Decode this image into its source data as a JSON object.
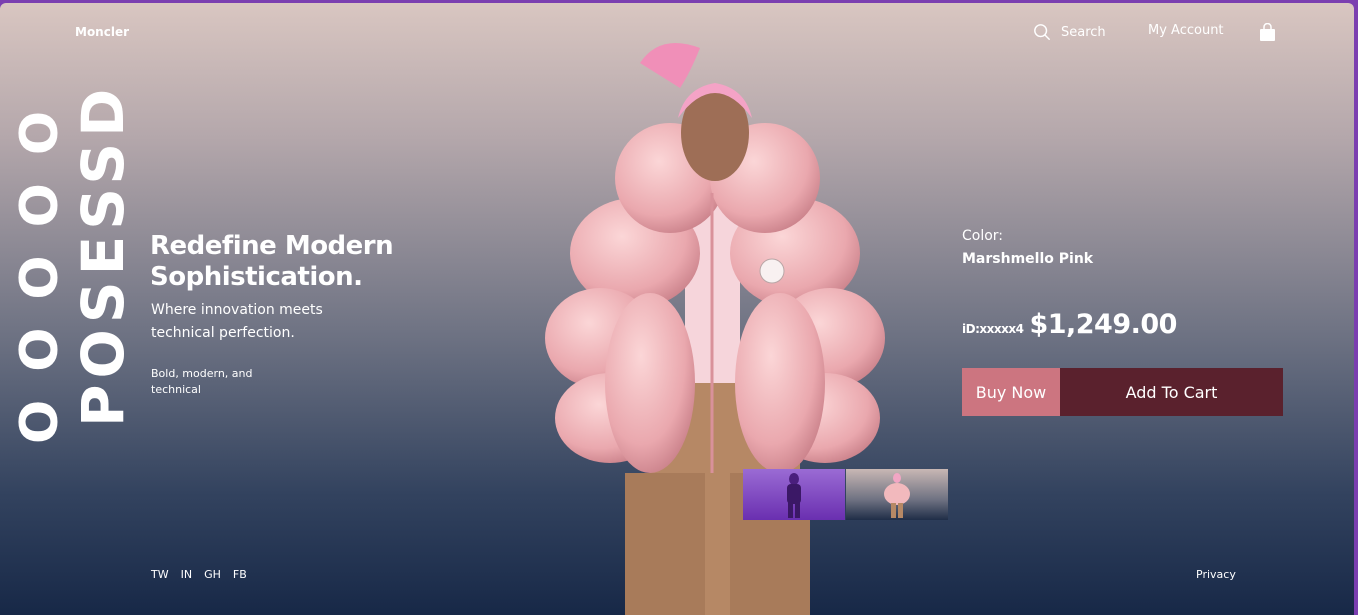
{
  "brand": {
    "name": "Moncler"
  },
  "header": {
    "search_label": "Search",
    "account_label": "My Account",
    "icons": {
      "search": "search-icon",
      "cart": "shopping-bag-icon"
    }
  },
  "vertical_text": {
    "big": "POSESSD",
    "small": "OOOOO"
  },
  "hero": {
    "headline": "Redefine Modern Sophistication.",
    "subheadline": "Where innovation meets technical perfection.",
    "tagline": "Bold, modern, and technical"
  },
  "social": [
    "TW",
    "IN",
    "GH",
    "FB"
  ],
  "footer": {
    "privacy": "Privacy"
  },
  "product": {
    "color_label": "Color:",
    "color_value": "Marshmello Pink",
    "id_label": "iD:xxxxx4",
    "price": "$1,249.00"
  },
  "actions": {
    "buy_now": "Buy Now",
    "add_to_cart": "Add To Cart"
  },
  "colors": {
    "accent_pink": "#cc7580",
    "accent_maroon": "#5a212d",
    "frame_border": "#7b3fb0",
    "jacket_pink": "#f2b9bd"
  }
}
